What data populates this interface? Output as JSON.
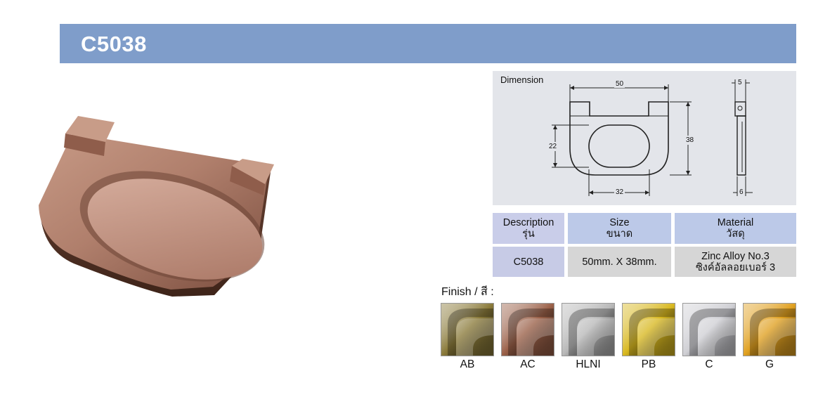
{
  "header": {
    "title": "C5038",
    "color": "#7f9dca"
  },
  "dimension": {
    "title": "Dimension",
    "width_label": "50",
    "height_label": "38",
    "inner_height_label": "22",
    "inner_width_label": "32",
    "thickness_label": "5",
    "base_label": "6"
  },
  "spec_table": {
    "headers": [
      {
        "en": "Description",
        "th": "รุ่น"
      },
      {
        "en": "Size",
        "th": "ขนาด"
      },
      {
        "en": "Material",
        "th": "วัสดุ"
      }
    ],
    "row": {
      "model": "C5038",
      "size": "50mm. X 38mm.",
      "material_en": "Zinc Alloy No.3",
      "material_th": "ซิงค์อัลลอยเบอร์ 3"
    }
  },
  "finish": {
    "label": "Finish / สี :",
    "options": [
      {
        "code": "AB",
        "color": "#8a7a3a"
      },
      {
        "code": "AC",
        "color": "#9a6048"
      },
      {
        "code": "HLNI",
        "color": "#b8b8b8"
      },
      {
        "code": "PB",
        "color": "#d8b820"
      },
      {
        "code": "C",
        "color": "#cfcfd4"
      },
      {
        "code": "G",
        "color": "#e0a020"
      }
    ]
  }
}
